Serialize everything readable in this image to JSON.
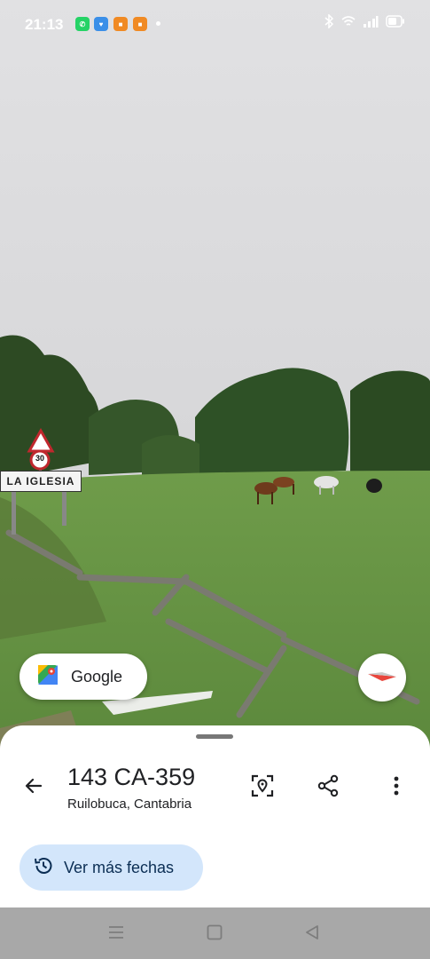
{
  "status_bar": {
    "time": "21:13",
    "app_icons": [
      "whatsapp-icon",
      "heart-app-icon",
      "orange-app-icon",
      "orange-app-icon"
    ],
    "right_icons": [
      "bluetooth-icon",
      "wifi-icon",
      "signal-icon",
      "battery-icon"
    ]
  },
  "scene": {
    "road_sign_text": "LA IGLESIA",
    "speed_limit": "30"
  },
  "google_chip": {
    "label": "Google"
  },
  "sheet": {
    "title": "143 CA-359",
    "subtitle": "Ruilobuca, Cantabria",
    "more_dates_label": "Ver más fechas",
    "actions": [
      "location-search-icon",
      "share-icon",
      "more-vert-icon"
    ]
  },
  "nav_bar": {
    "buttons": [
      "recents-icon",
      "home-icon",
      "back-triangle-icon"
    ]
  },
  "colors": {
    "accent_chip": "#d3e6fb",
    "accent_text": "#0b2e54",
    "navbar": "#a8a8a8"
  }
}
